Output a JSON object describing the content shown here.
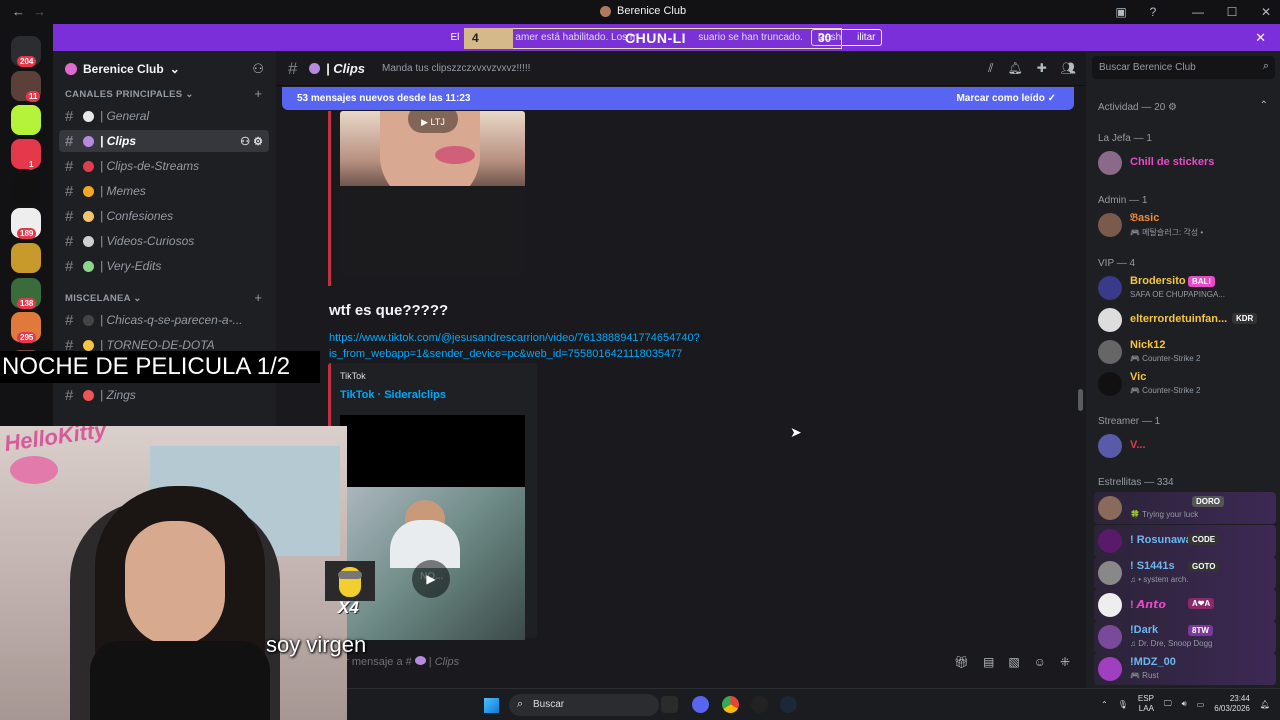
{
  "window": {
    "title": "Berenice Club",
    "back": "←",
    "forward": "→"
  },
  "banner": {
    "text_left": "El",
    "text_mid": "amer está habilitado. Los m",
    "text_right": "suario se han truncado.",
    "button": "Desh",
    "button_tail": "ilitar"
  },
  "overlay": {
    "left": "4",
    "center": "CHUN-LI",
    "right": "30",
    "progress": 0.13
  },
  "server": {
    "name": "Berenice Club"
  },
  "servers": [
    {
      "badge": "204",
      "color": "#2b2d31"
    },
    {
      "badge": "11",
      "color": "#5a4038"
    },
    {
      "badge": "",
      "color": "#b5f23a"
    },
    {
      "badge": "1",
      "color": "#e6384b"
    },
    {
      "badge": "",
      "color": "#111"
    },
    {
      "badge": "189",
      "color": "#eeeeee"
    },
    {
      "badge": "",
      "color": "#c79a2b"
    },
    {
      "badge": "138",
      "color": "#3a6b3a"
    },
    {
      "badge": "295",
      "color": "#e07a3a"
    },
    {
      "badge": "",
      "color": "#7a4a3a"
    }
  ],
  "categories": {
    "principal": "CANALES PRINCIPALES",
    "misc": "MISCELANEA"
  },
  "channels_main": [
    {
      "name": "General",
      "color": "#e8e8e8"
    },
    {
      "name": "Clips",
      "color": "#b58ae0"
    },
    {
      "name": "Clips-de-Streams",
      "color": "#e33b4f"
    },
    {
      "name": "Memes",
      "color": "#f5a623"
    },
    {
      "name": "Confesiones",
      "color": "#f6c36b"
    },
    {
      "name": "Videos-Curiosos",
      "color": "#d0d0d0"
    },
    {
      "name": "Very-Edits",
      "color": "#8bd68b"
    }
  ],
  "channels_misc": [
    {
      "name": "Chicas-q-se-parecen-a-...",
      "color": "#444"
    },
    {
      "name": "TORNEO-DE-DOTA",
      "color": "#f5c542"
    },
    {
      "name": "Picoteando",
      "color": "#f0c0d8"
    },
    {
      "name": "Zings",
      "color": "#e55"
    }
  ],
  "channel": {
    "name": "Clips",
    "topic": "Manda tus clipszzczxvxvzvxvz!!!!!",
    "header_icons": [
      "threads-icon",
      "bell-icon",
      "pin-icon",
      "members-icon"
    ]
  },
  "new_messages": {
    "text": "53 mensajes nuevos desde las 11:23",
    "action": "Marcar como leído"
  },
  "video1_label": "LTJ",
  "message": {
    "text": "wtf es que?????",
    "link_line1": "https://www.tiktok.com/@jesusandrescarrion/video/7613888941774654740?",
    "link_line2": "is_from_webapp=1&sender_device=pc&web_id=7558016421118035477",
    "embed_provider": "TikTok",
    "embed_title": "TikTok · Sideralclips",
    "embed_overlay": "NO..."
  },
  "composer": {
    "placeholder": "ar mensaje a #",
    "channel": "Clips"
  },
  "search": {
    "placeholder": "Buscar Berenice Club"
  },
  "members": {
    "activity": "Actividad — 20",
    "groups": [
      {
        "label": "La Jefa",
        "count": "— 1"
      },
      {
        "label": "Admin — 1"
      },
      {
        "label": "VIP — 4"
      },
      {
        "label": "Streamer — 1"
      },
      {
        "label": "Estrellitas — 334"
      }
    ],
    "list": [
      {
        "name": "Chill de stickers",
        "status": "",
        "tag": "",
        "color": "#e94ac8",
        "av": "#8a6a8a"
      },
      {
        "name": "𝔅asic",
        "status": "🎮 메탈슬러그: 각성 •",
        "tag": "",
        "color": "#f08a3a",
        "av": "#7a5a4a"
      },
      {
        "name": "Brodersito",
        "status": "SAFA OE CHUPAPINGA...",
        "tag": "BALI",
        "color": "#f5c542",
        "av": "#3a3a8a"
      },
      {
        "name": "elterrordetuinfan...",
        "status": "",
        "tag": "KDR",
        "color": "#f5c542",
        "av": "#ddd"
      },
      {
        "name": "Nick12",
        "status": "🎮 Counter-Strike 2",
        "tag": "",
        "color": "#f5c542",
        "av": "#666"
      },
      {
        "name": "Vic",
        "status": "🎮 Counter-Strike 2",
        "tag": "",
        "color": "#f5c542",
        "av": "#111"
      },
      {
        "name": "V...",
        "status": "",
        "tag": "",
        "color": "#e6384b",
        "av": "#5a5aaa"
      },
      {
        "name": "",
        "status": "🍀 Trying your luck",
        "tag": "DORO",
        "color": "#e6384b",
        "av": "#8a6a5a"
      },
      {
        "name": "! Rosunawa",
        "status": "",
        "tag": "CODE",
        "color": "#6bb8f0",
        "av": "#5a1a6a"
      },
      {
        "name": "! S1441s",
        "status": "♫ • system arch.",
        "tag": "GOTO",
        "color": "#6bb8f0",
        "av": "#888"
      },
      {
        "name": "! 𝘼𝙣𝙩𝙤",
        "status": "",
        "tag": "A❤A",
        "color": "#e94ac8",
        "av": "#eee"
      },
      {
        "name": "!Dark",
        "status": "♫ Dr. Dre, Snoop Dogg",
        "tag": "8TW",
        "color": "#6bb8f0",
        "av": "#7a4a9a"
      },
      {
        "name": "!MDZ_00",
        "status": "🎮 Rust",
        "tag": "",
        "color": "#6bb8f0",
        "av": "#a040c0"
      }
    ]
  },
  "stream": {
    "noche": "NOCHE DE PELICULA 1/2",
    "caption": "soy virgen",
    "hello": "HelloKitty",
    "combo": "X4"
  },
  "taskbar": {
    "search": "Buscar",
    "lang1": "ESP",
    "lang2": "LAA",
    "time": "23:44",
    "date": "6/03/2026"
  }
}
